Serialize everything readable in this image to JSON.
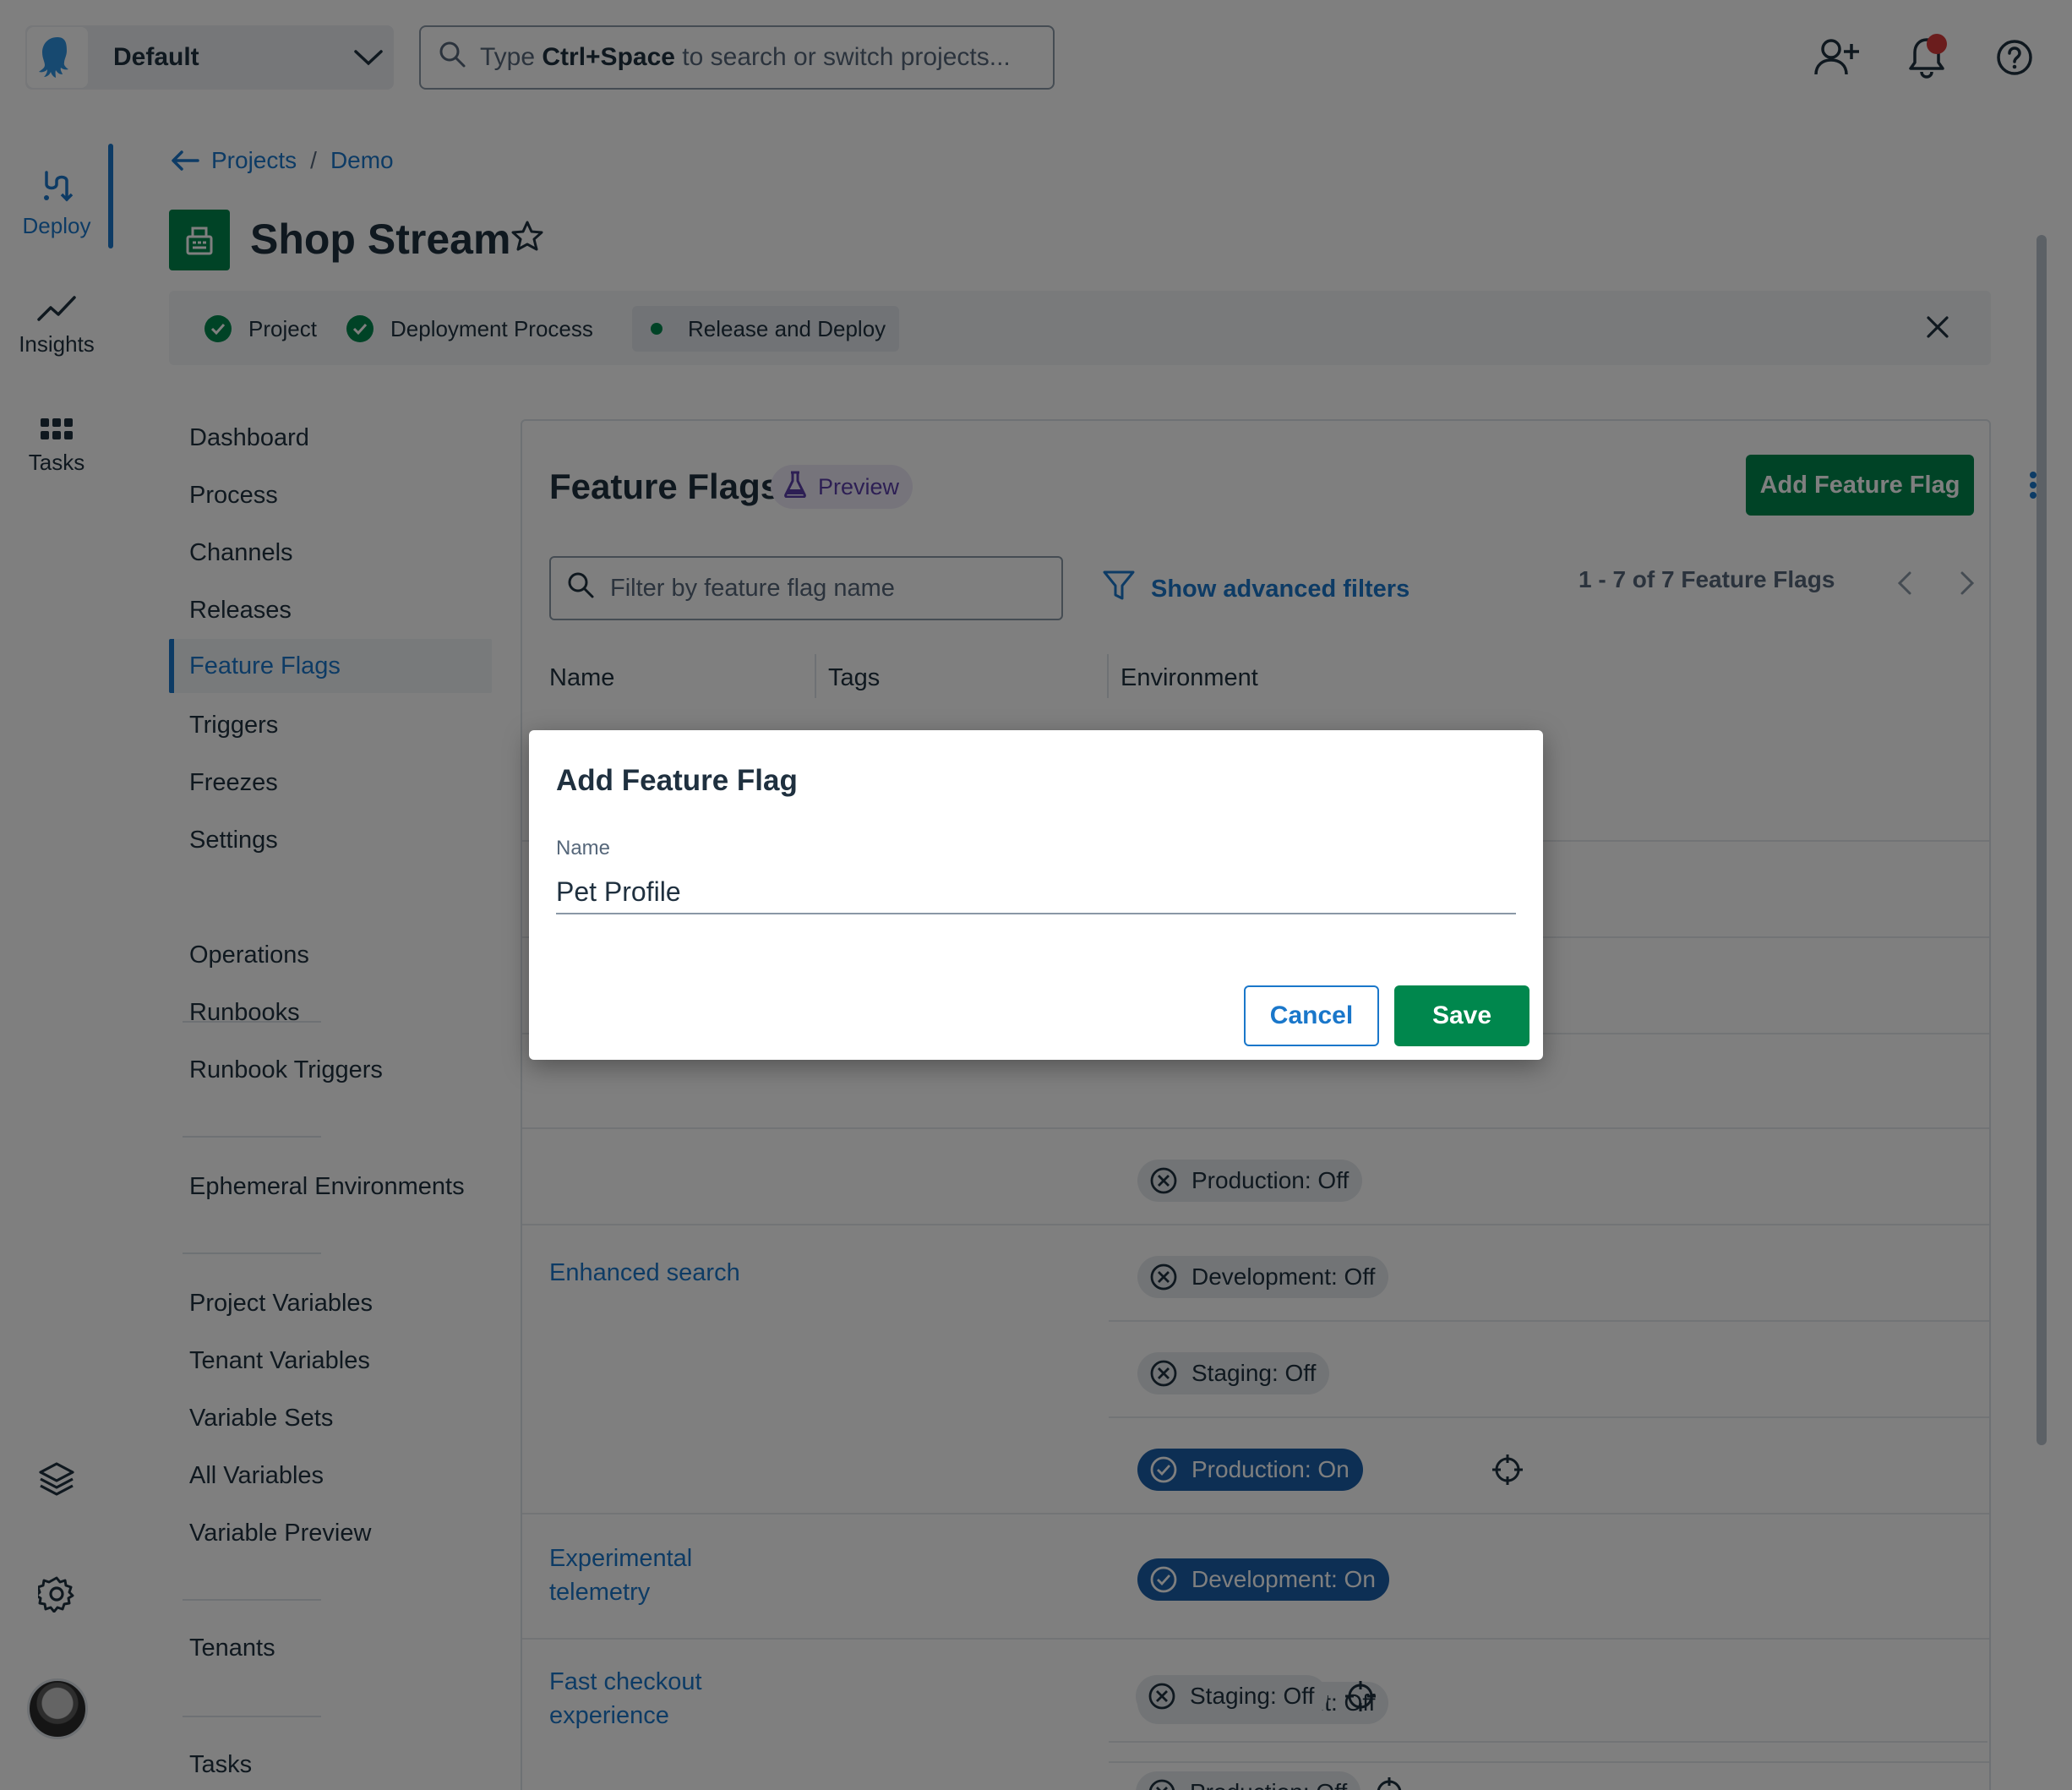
{
  "topbar": {
    "space_name": "Default",
    "search_placeholder_pre": "Type ",
    "search_placeholder_key": "Ctrl+Space",
    "search_placeholder_post": " to search or switch projects..."
  },
  "rail": {
    "items": [
      {
        "label": "Deploy",
        "icon": "deploy-icon"
      },
      {
        "label": "Insights",
        "icon": "insights-icon"
      },
      {
        "label": "Tasks",
        "icon": "tasks-icon"
      }
    ]
  },
  "breadcrumb": {
    "root": "Projects",
    "separator": "/",
    "current": "Demo"
  },
  "project": {
    "title": "Shop Stream"
  },
  "progress_steps": [
    {
      "label": "Project",
      "state": "done"
    },
    {
      "label": "Deployment Process",
      "state": "done"
    },
    {
      "label": "Release and Deploy",
      "state": "current"
    }
  ],
  "project_nav": {
    "group1": [
      "Dashboard",
      "Process",
      "Channels",
      "Releases",
      "Feature Flags",
      "Triggers",
      "Freezes",
      "Settings"
    ],
    "group2": [
      "Operations",
      "Runbooks",
      "Runbook Triggers"
    ],
    "group3": [
      "Ephemeral Environments"
    ],
    "group4": [
      "Project Variables",
      "Tenant Variables",
      "Variable Sets",
      "All Variables",
      "Variable Preview"
    ],
    "group5": [
      "Tenants"
    ],
    "group6": [
      "Tasks"
    ],
    "active": "Feature Flags"
  },
  "feature_flags": {
    "title": "Feature Flags",
    "preview_label": "Preview",
    "add_button": "Add Feature Flag",
    "filter_placeholder": "Filter by feature flag name",
    "advanced_filters": "Show advanced filters",
    "pager_text": "1 - 7 of 7 Feature Flags",
    "columns": [
      "Name",
      "Tags",
      "Environment"
    ],
    "partial_chip": "Production: Off",
    "rows": [
      {
        "name": "Enhanced search",
        "envs": [
          {
            "label": "Development: Off",
            "on": false
          },
          {
            "label": "Staging: Off",
            "on": false
          },
          {
            "label": "Production: On",
            "on": true
          }
        ]
      },
      {
        "name_line1": "Experimental",
        "name_line2": "telemetry",
        "envs": [
          {
            "label": "Development: On",
            "on": true
          }
        ]
      },
      {
        "name_line1": "Fast checkout",
        "name_line2": "experience",
        "envs": [
          {
            "label": "Development: Off",
            "on": false
          },
          {
            "label": "Staging: Off",
            "on": false
          },
          {
            "label": "Production: Off",
            "on": false
          }
        ]
      }
    ]
  },
  "modal": {
    "title": "Add Feature Flag",
    "name_label": "Name",
    "name_value": "Pet Profile",
    "cancel": "Cancel",
    "save": "Save"
  },
  "colors": {
    "accent": "#1a77ca",
    "brand_green": "#00874d",
    "on_chip": "#1a5fa8"
  }
}
